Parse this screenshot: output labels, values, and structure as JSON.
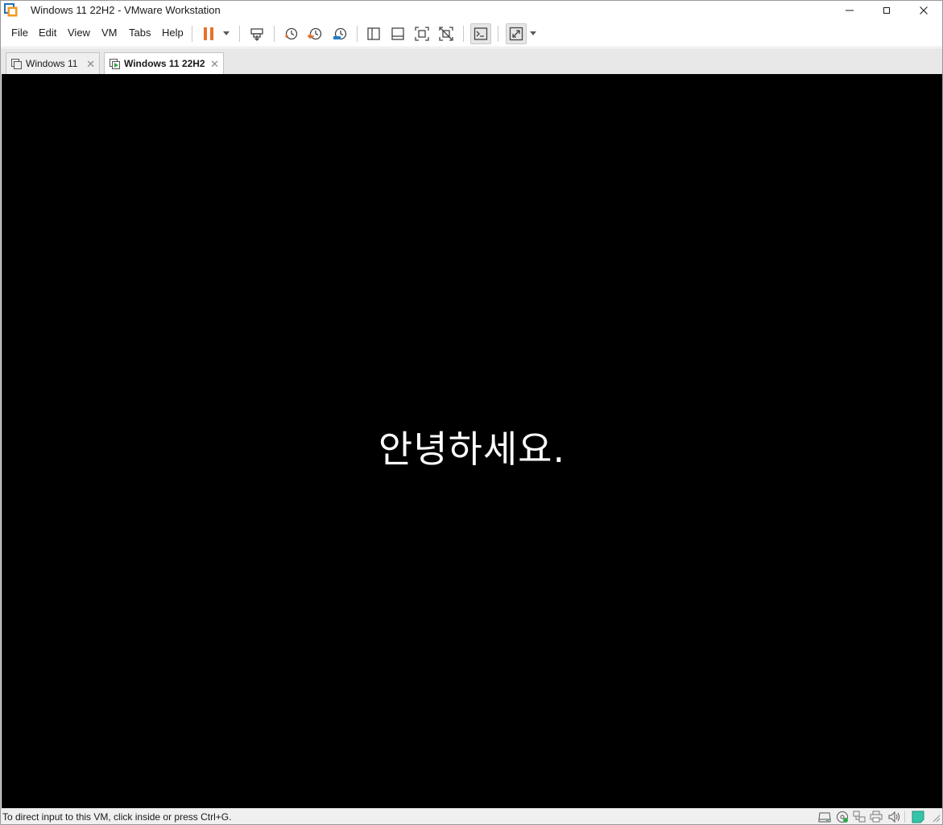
{
  "window": {
    "title": "Windows 11 22H2 - VMware Workstation"
  },
  "menu": {
    "items": [
      "File",
      "Edit",
      "View",
      "VM",
      "Tabs",
      "Help"
    ]
  },
  "toolbar": {
    "icons": [
      "pause-icon",
      "send-ctrl-alt-del-icon",
      "snapshot-take-icon",
      "snapshot-revert-icon",
      "snapshot-manager-icon",
      "show-library-icon",
      "show-thumbnail-bar-icon",
      "full-screen-icon",
      "unity-icon",
      "console-view-icon",
      "stretch-guest-icon"
    ],
    "accent_pause": "#e8712a",
    "accent_snapshot_revert": "#e8712a",
    "accent_snapshot_manager": "#1e7fc8"
  },
  "tabs": [
    {
      "label": "Windows 11",
      "active": false
    },
    {
      "label": "Windows 11 22H2",
      "active": true
    }
  ],
  "vm": {
    "screen_text": "안녕하세요.",
    "background": "#000000"
  },
  "status": {
    "text": "To direct input to this VM, click inside or press Ctrl+G.",
    "device_icons": [
      "hard-disk-icon",
      "cd-dvd-icon",
      "network-adapter-icon",
      "printer-icon",
      "sound-card-icon",
      "messages-icon"
    ]
  }
}
